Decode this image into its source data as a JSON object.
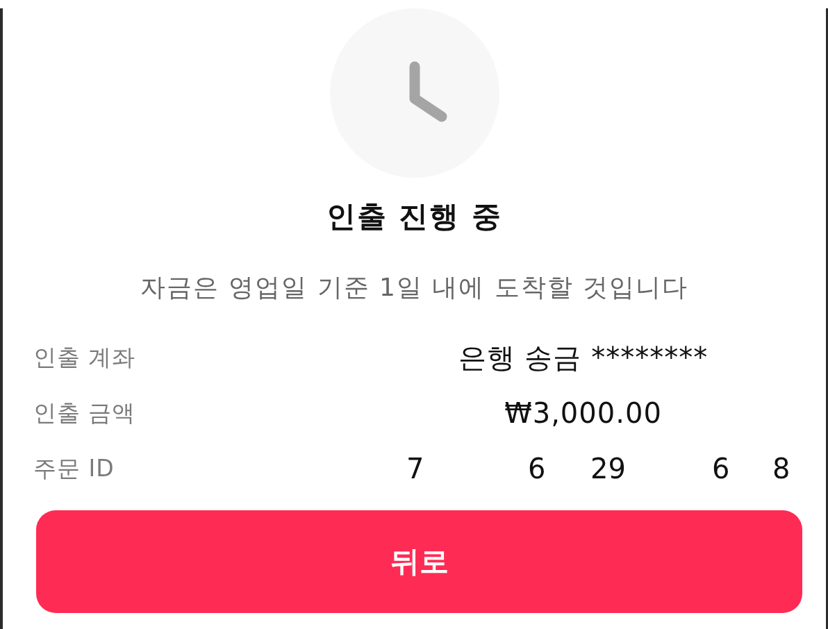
{
  "title": "인출 진행 중",
  "message": "자금은 영업일 기준 1일 내에 도착할 것입니다",
  "details": [
    {
      "kind": "text",
      "label": "인출 계좌",
      "value": "은행 송금 ********"
    },
    {
      "kind": "text",
      "label": "인출 금액",
      "value": "₩3,000.00"
    },
    {
      "kind": "fragments",
      "label": "주문 ID",
      "fragments": [
        "7",
        "6",
        "29",
        "6",
        "8"
      ]
    }
  ],
  "button": {
    "label": "뒤로"
  }
}
